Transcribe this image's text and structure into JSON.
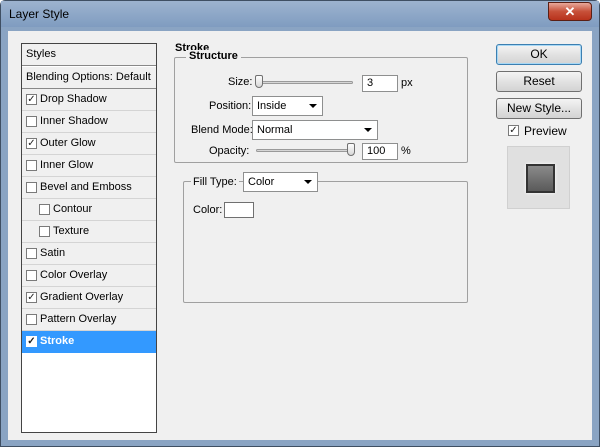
{
  "window": {
    "title": "Layer Style",
    "close_label": "✕"
  },
  "styles_list": {
    "header": "Styles",
    "blending": "Blending Options: Default",
    "items": [
      {
        "label": "Drop Shadow",
        "checked": true
      },
      {
        "label": "Inner Shadow",
        "checked": false
      },
      {
        "label": "Outer Glow",
        "checked": true
      },
      {
        "label": "Inner Glow",
        "checked": false
      },
      {
        "label": "Bevel and Emboss",
        "checked": false
      },
      {
        "label": "Contour",
        "checked": false
      },
      {
        "label": "Texture",
        "checked": false
      },
      {
        "label": "Satin",
        "checked": false
      },
      {
        "label": "Color Overlay",
        "checked": false
      },
      {
        "label": "Gradient Overlay",
        "checked": true
      },
      {
        "label": "Pattern Overlay",
        "checked": false
      },
      {
        "label": "Stroke",
        "checked": true
      }
    ]
  },
  "stroke": {
    "title": "Stroke",
    "structure": {
      "title": "Structure",
      "size_label": "Size:",
      "size_value": "3",
      "size_unit": "px",
      "position_label": "Position:",
      "position_value": "Inside",
      "blend_label": "Blend Mode:",
      "blend_value": "Normal",
      "opacity_label": "Opacity:",
      "opacity_value": "100",
      "opacity_unit": "%"
    },
    "fill": {
      "type_label": "Fill Type:",
      "type_value": "Color",
      "color_label": "Color:",
      "color_value": "#ffffff"
    }
  },
  "buttons": {
    "ok": "OK",
    "reset": "Reset",
    "new_style": "New Style...",
    "preview_label": "Preview",
    "preview_checked": true
  },
  "colors": {
    "selection": "#3399ff",
    "titlebar": "#8aa4c3"
  },
  "icons": {
    "close": "close-icon",
    "checkbox": "checkbox-icon",
    "dropdown": "chevron-down-icon"
  }
}
